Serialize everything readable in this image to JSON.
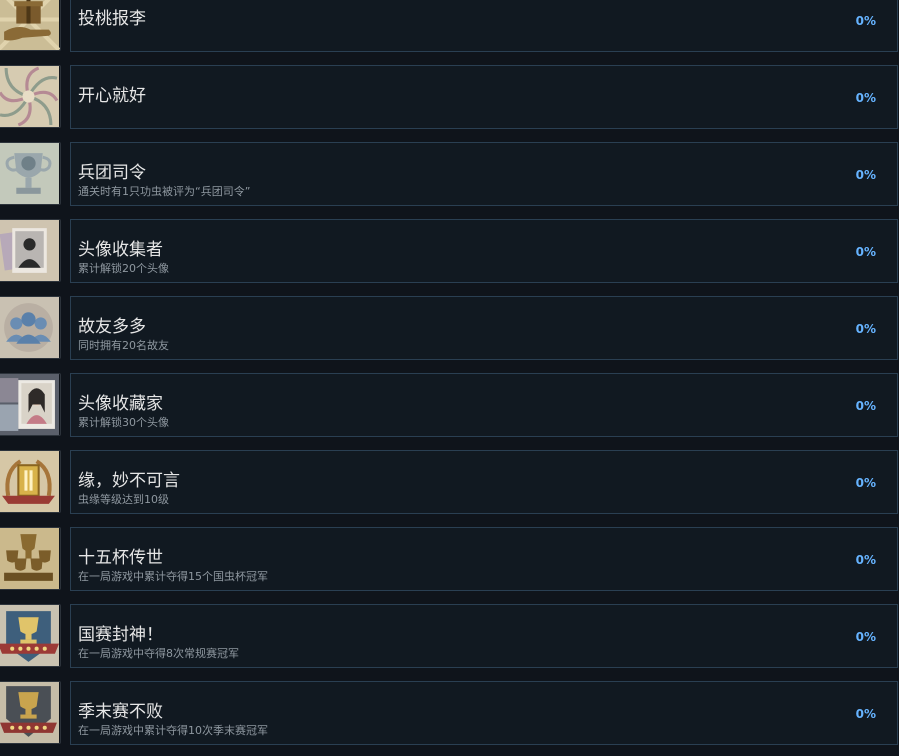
{
  "achievements": [
    {
      "title": "投桃报李",
      "description": "",
      "percent": "0%",
      "icon": "gift-hand-icon"
    },
    {
      "title": "开心就好",
      "description": "",
      "percent": "0%",
      "icon": "spiral-burst-icon"
    },
    {
      "title": "兵团司令",
      "description": "通关时有1只功虫被评为“兵团司令”",
      "percent": "0%",
      "icon": "trophy-icon"
    },
    {
      "title": "头像收集者",
      "description": "累计解锁20个头像",
      "percent": "0%",
      "icon": "portrait-cards-icon"
    },
    {
      "title": "故友多多",
      "description": "同时拥有20名故友",
      "percent": "0%",
      "icon": "friends-group-icon"
    },
    {
      "title": "头像收藏家",
      "description": "累计解锁30个头像",
      "percent": "0%",
      "icon": "portrait-collection-icon"
    },
    {
      "title": "缘，妙不可言",
      "description": "虫缘等级达到10级",
      "percent": "0%",
      "icon": "level-ten-badge-icon"
    },
    {
      "title": "十五杯传世",
      "description": "在一局游戏中累计夺得15个国虫杯冠军",
      "percent": "0%",
      "icon": "trophy-pile-icon"
    },
    {
      "title": "国赛封神！",
      "description": "在一局游戏中夺得8次常规赛冠军",
      "percent": "0%",
      "icon": "champion-cup-banner-icon"
    },
    {
      "title": "季末赛不败",
      "description": "在一局游戏中累计夺得10次季末赛冠军",
      "percent": "0%",
      "icon": "champion-shield-icon"
    }
  ]
}
